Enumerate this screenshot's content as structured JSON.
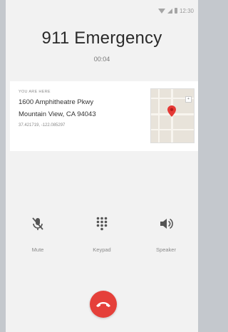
{
  "status_bar": {
    "time": "12:30",
    "icons": [
      "wifi-icon",
      "signal-icon",
      "battery-icon"
    ]
  },
  "call": {
    "title": "911 Emergency",
    "timer": "00:04"
  },
  "location": {
    "label": "YOU ARE HERE",
    "address_line1": "1600 Amphitheatre Pkwy",
    "address_line2": "Mountain View, CA 94043",
    "coordinates": "37.421719, -122.085297"
  },
  "controls": [
    {
      "label": "Mute",
      "icon": "mic-off-icon"
    },
    {
      "label": "Keypad",
      "icon": "dialpad-icon"
    },
    {
      "label": "Speaker",
      "icon": "volume-icon"
    }
  ],
  "end_call": {
    "icon": "end-call-icon",
    "color": "#e5403a"
  },
  "colors": {
    "accent_red": "#e5403a",
    "background": "#f2f2f2",
    "card": "#ffffff"
  }
}
